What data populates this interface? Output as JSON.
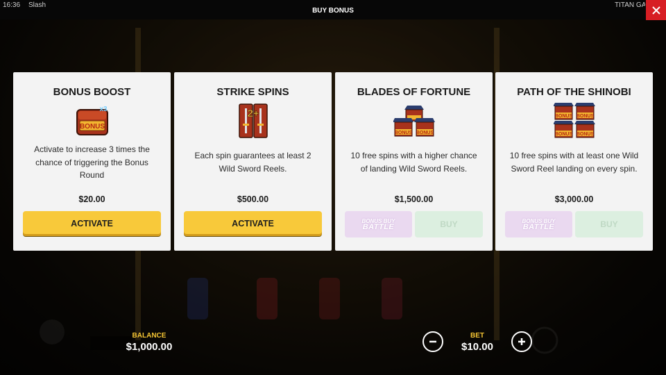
{
  "topbar": {
    "time": "16:36",
    "game": "Slash",
    "title": "BUY BONUS",
    "brand": "TITAN GA",
    "close_icon": "close-icon"
  },
  "cards": [
    {
      "title": "BONUS BOOST",
      "icon": "bonus-chest-x3-icon",
      "description": "Activate to increase 3 times the chance of triggering the Bonus Round",
      "price": "$20.00",
      "button": "ACTIVATE"
    },
    {
      "title": "STRIKE SPINS",
      "icon": "wild-swords-2plus-icon",
      "description": "Each spin guarantees at least 2 Wild Sword Reels.",
      "price": "$500.00",
      "button": "ACTIVATE"
    },
    {
      "title": "BLADES OF FORTUNE",
      "icon": "three-pagoda-bonus-icon",
      "description": "10 free spins with a higher chance of landing Wild Sword Reels.",
      "price": "$1,500.00",
      "battle_top": "BONUS BUY",
      "battle_big": "BATTLE",
      "button": "BUY"
    },
    {
      "title": "PATH OF THE SHINOBI",
      "icon": "four-pagoda-bonus-icon",
      "description": "10 free spins with at least one Wild Sword Reel landing on every spin.",
      "price": "$3,000.00",
      "battle_top": "BONUS BUY",
      "battle_big": "BATTLE",
      "button": "BUY"
    }
  ],
  "footer": {
    "balance_label": "BALANCE",
    "balance_value": "$1,000.00",
    "bet_label": "BET",
    "bet_value": "$10.00",
    "minus_icon": "minus-icon",
    "plus_icon": "plus-icon"
  },
  "colors": {
    "accent_yellow": "#f8c93a",
    "label_yellow": "#f5c533",
    "close_red": "#d71e24",
    "card_bg": "#f3f3f3"
  }
}
